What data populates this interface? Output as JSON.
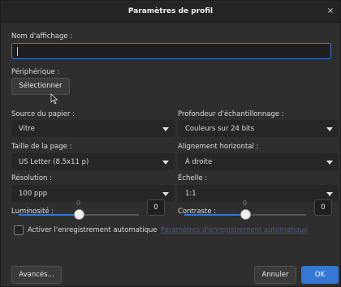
{
  "window": {
    "title": "Paramètres de profil",
    "close_glyph": "×"
  },
  "display_name": {
    "label": "Nom d'affichage :",
    "value": ""
  },
  "device": {
    "label": "Périphérique :",
    "select_button": "Sélectionner"
  },
  "paper_source": {
    "label": "Source du papier :",
    "selected": "Vitre"
  },
  "sample_depth": {
    "label": "Profondeur d'échantillonnage :",
    "selected": "Couleurs sur 24 bits"
  },
  "page_size": {
    "label": "Taille de la page :",
    "selected": "US Letter (8.5x11 p)"
  },
  "horizontal_alignment": {
    "label": "Alignement horizontal :",
    "selected": "À droite"
  },
  "resolution": {
    "label": "Résolution :",
    "selected": "100 ppp"
  },
  "scale": {
    "label": "Échelle :",
    "selected": "1:1"
  },
  "brightness": {
    "label": "Luminosité :",
    "slider_value_label": "0",
    "value": "0",
    "level_fraction": 0.5
  },
  "contrast": {
    "label": "Contraste :",
    "slider_value_label": "0",
    "value": "0",
    "level_fraction": 0.5
  },
  "auto_save": {
    "label": "Activer l'enregistrement automatique",
    "checked": false,
    "settings_link": "Paramètres d'enregistrement automatique"
  },
  "footer": {
    "advanced": "Avancés...",
    "cancel": "Annuler",
    "ok": "OK"
  },
  "colors": {
    "accent": "#3478d4",
    "background": "#2e2e2e",
    "titlebar": "#242424"
  }
}
